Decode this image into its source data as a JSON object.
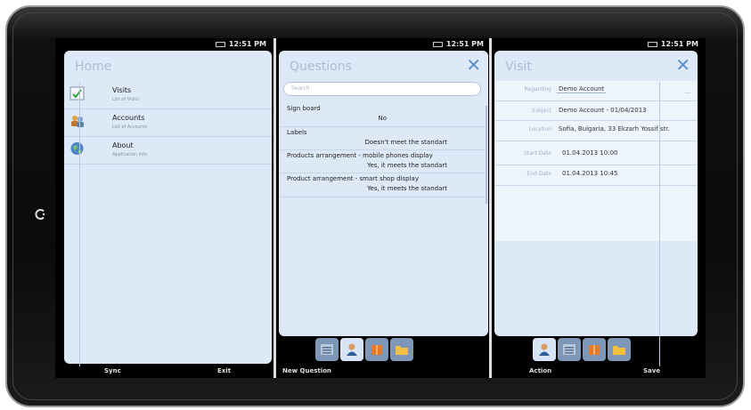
{
  "status": {
    "time": "12:51 PM"
  },
  "home": {
    "title": "Home",
    "items": [
      {
        "title": "Visits",
        "subtitle": "List of Visits"
      },
      {
        "title": "Accounts",
        "subtitle": "List of Accounts"
      },
      {
        "title": "About",
        "subtitle": "Application Info"
      }
    ],
    "sync_label": "Sync",
    "exit_label": "Exit"
  },
  "questions": {
    "title": "Questions",
    "search_placeholder": "Search",
    "items": [
      {
        "label": "Sign board",
        "answer": "No"
      },
      {
        "label": "Labels",
        "answer": "Doesn't meet the standart"
      },
      {
        "label": "Products arrangement - mobile phones display",
        "answer": "Yes, it meets the standart"
      },
      {
        "label": "Product arrangement - smart shop display",
        "answer": "Yes, it meets the standart"
      }
    ],
    "new_question_label": "New Question"
  },
  "visit": {
    "title": "Visit",
    "fields": [
      {
        "label": "Regarding",
        "value": "Demo Account"
      },
      {
        "label": "Subject",
        "value": "Demo Account - 01/04/2013"
      },
      {
        "label": "Location",
        "value": "Sofia, Bulgaria, 33 Ekzarh Yossif str."
      },
      {
        "label": "Start Date",
        "value": "01.04.2013 10:00"
      },
      {
        "label": "End Date",
        "value": "01.04.2013 10:45"
      }
    ],
    "more_label": "...",
    "action_label": "Action",
    "save_label": "Save"
  },
  "icons": {
    "home_button": "home-button-icon",
    "close": "close-icon",
    "visits": "visits-check-icon",
    "accounts": "accounts-people-icon",
    "about": "about-globe-icon",
    "tabs": [
      "list-icon",
      "contact-icon",
      "product-box-icon",
      "folder-icon"
    ]
  },
  "colors": {
    "panel": "#dde9f7",
    "accent": "#5b8fc7",
    "title": "#a8bed8",
    "tab": "#7e97b8"
  }
}
